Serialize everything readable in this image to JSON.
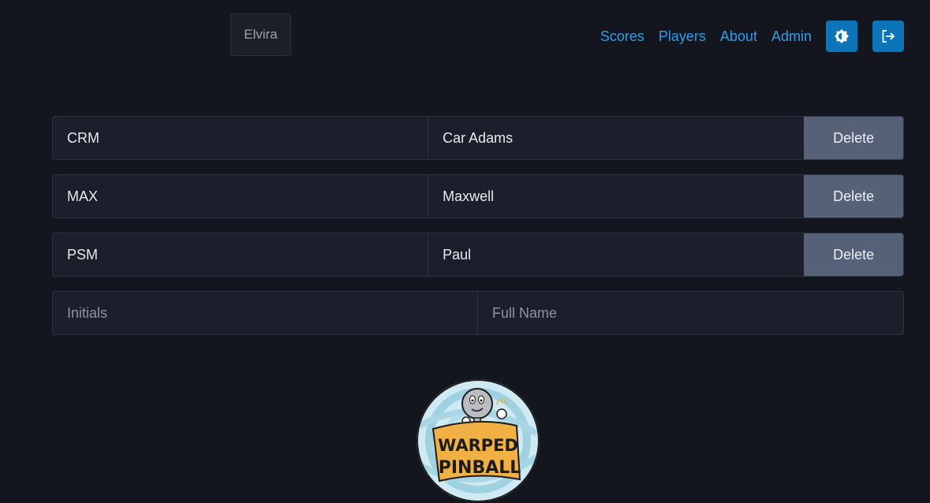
{
  "header": {
    "machine_name": "Elvira",
    "nav": [
      "Scores",
      "Players",
      "About",
      "Admin"
    ],
    "theme_button_icon": "brightness-icon",
    "logout_button_icon": "logout-icon"
  },
  "players": [
    {
      "initials": "CRM",
      "full_name": "Car Adams",
      "delete_label": "Delete"
    },
    {
      "initials": "MAX",
      "full_name": "Maxwell",
      "delete_label": "Delete"
    },
    {
      "initials": "PSM",
      "full_name": "Paul",
      "delete_label": "Delete"
    }
  ],
  "new_player": {
    "initials_placeholder": "Initials",
    "initials_value": "",
    "name_placeholder": "Full Name",
    "name_value": ""
  },
  "logo": {
    "text_line1": "WARPED",
    "text_line2": "PINBALL"
  },
  "colors": {
    "background": "#13161f",
    "link": "#2f9ee8",
    "icon_button": "#0c74b8",
    "delete_button": "#566178"
  }
}
